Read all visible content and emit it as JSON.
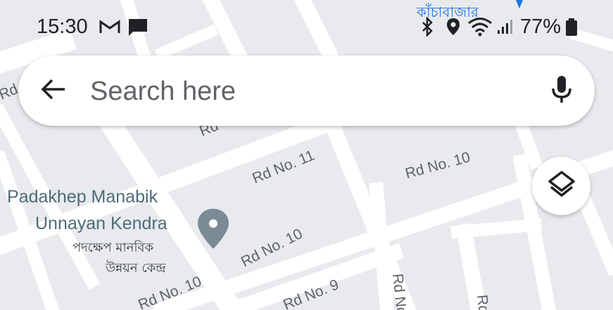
{
  "status_bar": {
    "time": "15:30",
    "battery": "77%",
    "icons": [
      "gmail-icon",
      "message-icon",
      "bluetooth-icon",
      "location-icon",
      "wifi-icon",
      "signal-icon",
      "battery-icon"
    ]
  },
  "search": {
    "placeholder": "Search here",
    "back_icon": "arrow-left-icon",
    "mic_icon": "microphone-icon"
  },
  "layers": {
    "icon": "layers-icon"
  },
  "map": {
    "market_label": "কাঁচাবাজার",
    "roads": [
      "Rd N",
      "Rd",
      "Rd No. 11",
      "Rd No. 10",
      "Rd No. 10",
      "Rd No. 10",
      "Rd No. 9",
      "Rd No",
      "Rd"
    ],
    "poi": {
      "name_line1": "Padakhep Manabik",
      "name_line2": "Unnayan Kendra",
      "local_line1": "পদক্ষেপ মানবিক",
      "local_line2": "উন্নয়ন কেন্দ্র",
      "icon": "location-pin-icon"
    }
  },
  "colors": {
    "map_bg": "#e8eaed",
    "road": "#ffffff",
    "pin": "#7b8b96",
    "market": "#1a73e8"
  }
}
